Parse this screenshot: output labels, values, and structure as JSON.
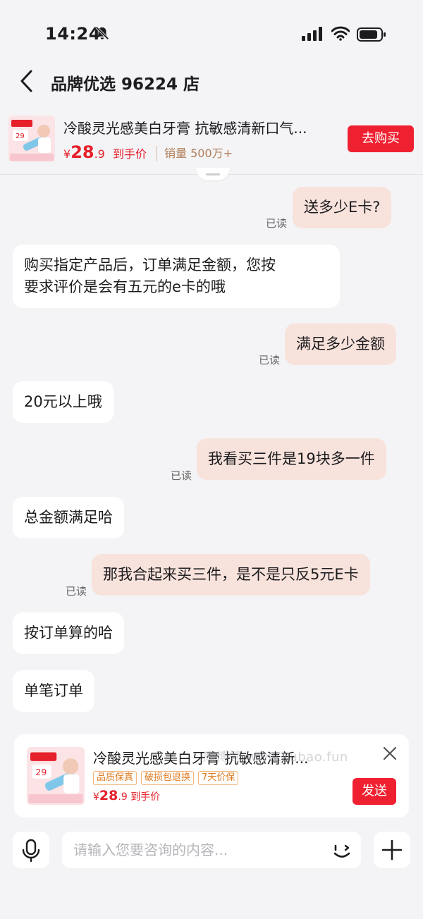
{
  "status": {
    "time": "14:24"
  },
  "header": {
    "title": "品牌优选 96224 店"
  },
  "pinned_product": {
    "name": "冷酸灵光感美白牙膏 抗敏感清新口气...",
    "currency": "¥",
    "price_int": "28",
    "price_dec": ".9",
    "price_note": "到手价",
    "sales": "销量 500万+",
    "buy_label": "去购买"
  },
  "messages": [
    {
      "from": "me",
      "text": "送多少E卡?",
      "read": "已读"
    },
    {
      "from": "shop",
      "lines": [
        "购买指定产品后，订单满足金额，您按",
        "要求评价是会有五元的e卡的哦"
      ]
    },
    {
      "from": "me",
      "text": "满足多少金额",
      "read": "已读"
    },
    {
      "from": "shop",
      "text": "20元以上哦"
    },
    {
      "from": "me",
      "text": "我看买三件是19块多一件",
      "read": "已读"
    },
    {
      "from": "shop",
      "text": "总金额满足哈"
    },
    {
      "from": "me",
      "text": "那我合起来买三件，是不是只反5元E卡",
      "read": "已读"
    },
    {
      "from": "shop",
      "text": "按订单算的哈"
    },
    {
      "from": "shop",
      "text": "单笔订单"
    }
  ],
  "send_card": {
    "name": "冷酸灵光感美白牙膏 抗敏感清新...",
    "tags": [
      "品质保真",
      "破损包退换",
      "7天价保"
    ],
    "currency": "¥",
    "price_int": "28",
    "price_dec": ".9",
    "price_note": "到手价",
    "send_label": "发送",
    "watermark": "库博鲸 www.kubao.fun"
  },
  "input": {
    "placeholder": "请输入您要咨询的内容..."
  },
  "colors": {
    "accent": "#ef2131",
    "bubble_mine": "#f8e2dc",
    "bubble_theirs": "#ffffff",
    "background": "#f4f4f6"
  },
  "icons": [
    "bell-muted-icon",
    "signal-icon",
    "wifi-icon",
    "battery-icon",
    "back-icon",
    "close-icon",
    "microphone-icon",
    "emoji-icon",
    "plus-icon"
  ]
}
